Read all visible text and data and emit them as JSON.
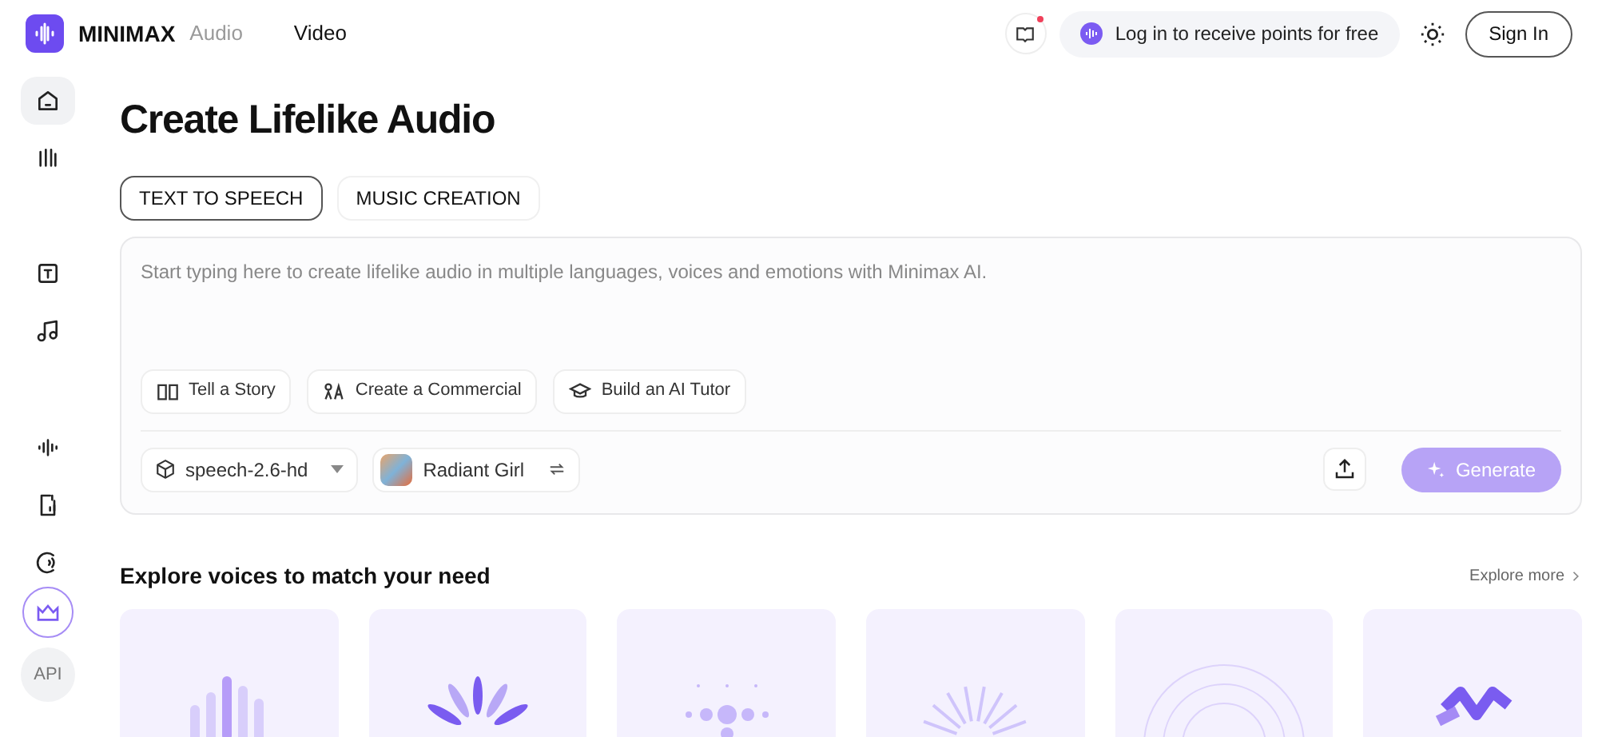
{
  "header": {
    "brand": "MINIMAX",
    "product": "Audio",
    "nav": [
      {
        "label": "Video"
      }
    ],
    "notification_dot": true,
    "login_prompt": "Log in to receive points for free",
    "sign_in": "Sign In"
  },
  "sidebar": {
    "items": [
      {
        "kind": "nav",
        "selected": true
      },
      {
        "kind": "nav",
        "selected": false
      },
      {
        "kind": "nav",
        "selected": false
      },
      {
        "kind": "nav",
        "selected": false
      },
      {
        "kind": "nav",
        "selected": false
      },
      {
        "kind": "nav",
        "selected": false
      },
      {
        "kind": "nav",
        "selected": false
      },
      {
        "kind": "premium",
        "selected": false
      },
      {
        "kind": "text",
        "label": "API",
        "selected": false
      }
    ]
  },
  "page": {
    "title": "Create Lifelike Audio",
    "tabs": [
      {
        "label": "TEXT TO SPEECH",
        "selected": true
      },
      {
        "label": "MUSIC CREATION",
        "selected": false
      }
    ],
    "editor": {
      "placeholder": "Start typing here to create lifelike audio in multiple languages, voices and emotions with Minimax AI.",
      "prompts": [
        {
          "label": "Tell a Story"
        },
        {
          "label": "Create a Commercial"
        },
        {
          "label": "Build an AI Tutor"
        }
      ],
      "model": "speech-2.6-hd",
      "voice": "Radiant Girl",
      "generate": "Generate",
      "generate_disabled": true
    },
    "explore": {
      "title": "Explore voices to match your need",
      "more": "Explore more",
      "cards": [
        {
          "kind": "bars"
        },
        {
          "kind": "petals"
        },
        {
          "kind": "dots"
        },
        {
          "kind": "sunburst"
        },
        {
          "kind": "rings"
        },
        {
          "kind": "ribbon"
        }
      ]
    }
  }
}
